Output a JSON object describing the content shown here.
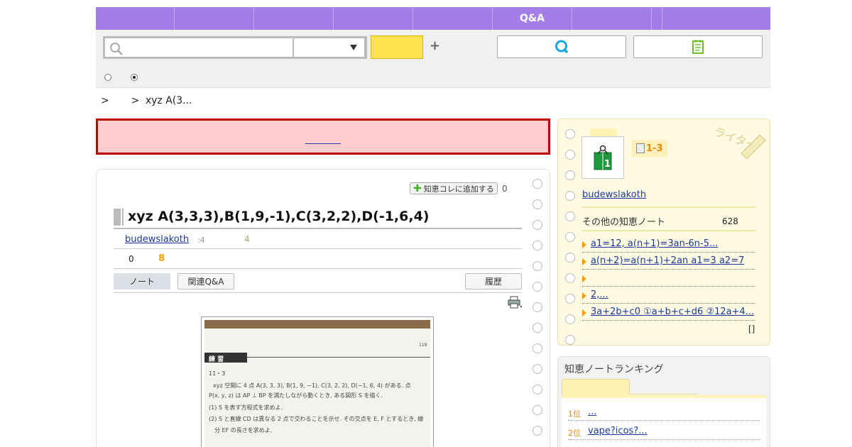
{
  "gnav": {
    "items": [
      "",
      "",
      "",
      "",
      "",
      "Q&A",
      "",
      "",
      ""
    ]
  },
  "toolbar": {
    "search_placeholder": "",
    "search_value": "",
    "select_value": "",
    "yellow_btn_label": "",
    "plus": "+",
    "qa_btn_label": "",
    "note_btn_label": "",
    "radio1_label": "",
    "radio2_label": ""
  },
  "breadcrumb": {
    "sep1": ">",
    "item1": "",
    "sep2": ">",
    "current": "xyz A(3..."
  },
  "alert": {
    "link_text": ""
  },
  "note": {
    "add_collect_label": "知恵コレに追加する",
    "collect_count": "0",
    "title": "xyz A(3,3,3),B(1,9,-1),C(3,2,2),D(-1,6,4)",
    "author": "budewslakoth",
    "meta_small": ":4",
    "meta_num": "4",
    "stat_left": "0",
    "stat_right": "8",
    "tabs": {
      "note": "ノート",
      "related_qa": "関連Q&A",
      "history": "履歴"
    },
    "photo": {
      "page_no": "119",
      "heading": "練 習",
      "number": "11・3",
      "line1": "xyz 空間に 4 点 A(3, 3, 3), B(1, 9, −1), C(3, 2, 2), D(−1, 6, 4) がある. 点",
      "line2": "P(x, y, z) は AP ⊥ BP を満たしながら動くとき, ある図形 S を描く.",
      "line3": "(1)  S を表す方程式を求めよ.",
      "line4": "(2)  S と直線 CD は異なる 2 点で交わることを示せ. その交点を E, F とするとき, 線",
      "line5": "分 EF の長さを求めよ."
    }
  },
  "sidebar": {
    "grade": "1-3",
    "writer_deco": "ライター",
    "author": "budewslakoth",
    "others_label": "その他の知恵ノート",
    "others_count": "628",
    "notes": [
      "a1=12, a(n+1)=3an-6n-5...",
      "a(n+2)=a(n+1)+2an a1=3 a2=7",
      "",
      "2,...",
      "3a+2b+c0 ①a+b+c+d6 ②12a+4..."
    ],
    "more": "[]"
  },
  "ranking": {
    "title": "知恵ノートランキング",
    "tab1": "",
    "tab2": "",
    "items": [
      {
        "rank": "1位",
        "label": "..."
      },
      {
        "rank": "2位",
        "label": "vape?icos?..."
      }
    ]
  },
  "colors": {
    "nav": "#a47ee8",
    "alert_bg": "#ffcdcd",
    "alert_border": "#c00000",
    "accent_orange": "#f0a000",
    "link": "#1a3aa0",
    "yellow_btn": "#ffe450"
  },
  "icons": {
    "search": "magnifier-icon",
    "dropdown": "triangle-down-icon",
    "qa": "q-letter-icon",
    "note": "notepad-icon",
    "print": "printer-icon",
    "plus_green": "green-plus-icon"
  }
}
